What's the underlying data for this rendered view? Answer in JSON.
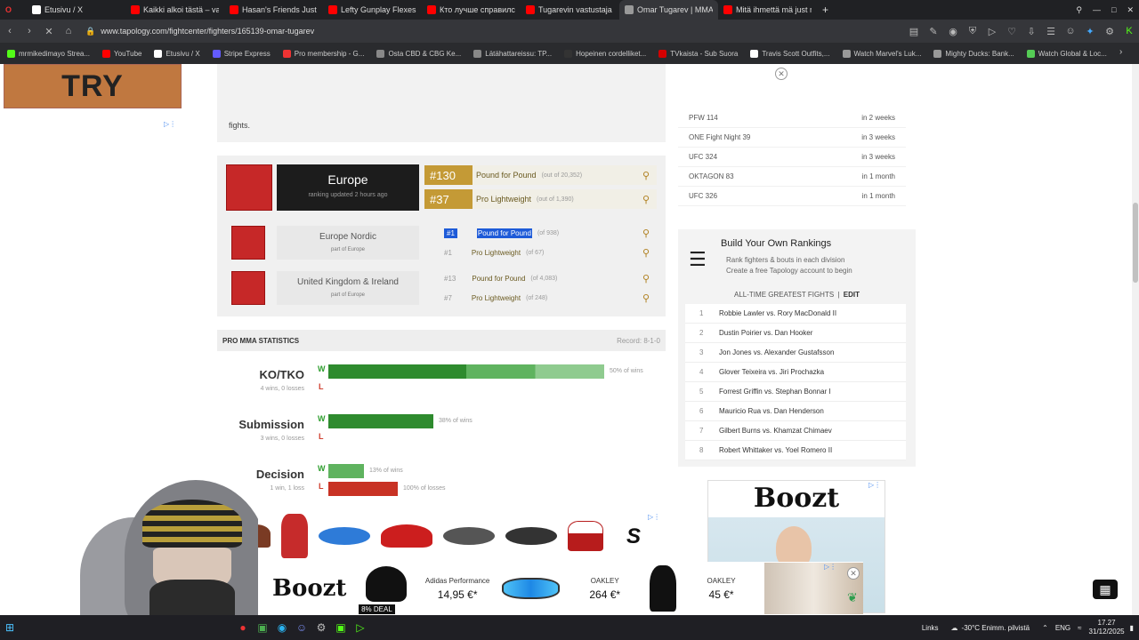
{
  "browser": {
    "tabs": [
      {
        "title": "Etusivu / X",
        "color": "#ffffff"
      },
      {
        "title": "Kaikki alkoi tästä – vapaas",
        "color": "#ff0000"
      },
      {
        "title": "Hasan's Friends Just Expo",
        "color": "#ff0000"
      },
      {
        "title": "Lefty Gunplay Flexes his C",
        "color": "#ff0000"
      },
      {
        "title": "Кто лучше справился?",
        "color": "#ff0000"
      },
      {
        "title": "Tugarevin vastustaja palja",
        "color": "#ff0000"
      },
      {
        "title": "Omar Tugarev | MMA Figh",
        "color": "#999999",
        "active": true
      },
      {
        "title": "Mitä ihmettä mä just näin",
        "color": "#ff0000"
      }
    ],
    "new_tab": "+",
    "url": "www.tapology.com/fightcenter/fighters/165139-omar-tugarev",
    "bookmarks": [
      {
        "label": "mrmikedimayo Strea...",
        "color": "#53fc18"
      },
      {
        "label": "YouTube",
        "color": "#ff0000"
      },
      {
        "label": "Etusivu / X",
        "color": "#ffffff"
      },
      {
        "label": "Stripe Express",
        "color": "#635bff"
      },
      {
        "label": "Pro membership - G...",
        "color": "#e33"
      },
      {
        "label": "Osta CBD & CBG Ke...",
        "color": "#888"
      },
      {
        "label": "Lätähattareissu: TP...",
        "color": "#888"
      },
      {
        "label": "Hopeinen cordelliket...",
        "color": "#333"
      },
      {
        "label": "TVkaista - Sub Suora",
        "color": "#d40000"
      },
      {
        "label": "Travis Scott Outfits,...",
        "color": "#fff"
      },
      {
        "label": "Watch Marvel's Luk...",
        "color": "#999"
      },
      {
        "label": "Mighty Ducks: Bank...",
        "color": "#999"
      },
      {
        "label": "Watch Global & Loc...",
        "color": "#5c5"
      }
    ]
  },
  "page": {
    "ad_try": "TRY",
    "fights_text": "fights.",
    "regions": {
      "europe": {
        "name": "Europe",
        "updated": "ranking updated 2 hours ago",
        "rank1": {
          "num": "#130",
          "label": "Pound for Pound",
          "of": "(out of 20,352)"
        },
        "rank2": {
          "num": "#37",
          "label": "Pro Lightweight",
          "of": "(out of 1,390)"
        }
      },
      "nordic": {
        "name": "Europe Nordic",
        "part": "part of Europe",
        "rank1": {
          "num": "#1",
          "label": "Pound for Pound",
          "of": "(of 938)"
        },
        "rank2": {
          "num": "#1",
          "label": "Pro Lightweight",
          "of": "(of 67)"
        }
      },
      "uk": {
        "name": "United Kingdom & Ireland",
        "part": "part of Europe",
        "rank1": {
          "num": "#13",
          "label": "Pound for Pound",
          "of": "(of 4,083)"
        },
        "rank2": {
          "num": "#7",
          "label": "Pro Lightweight",
          "of": "(of 248)"
        }
      }
    },
    "stats": {
      "title": "PRO MMA STATISTICS",
      "record": "Record: 8-1-0",
      "rows": [
        {
          "label": "KO/TKO",
          "sub": "4 wins, 0 losses",
          "w_pct": "50% of wins",
          "l_pct": "",
          "win_fraction": 0.5,
          "loss_fraction": 0
        },
        {
          "label": "Submission",
          "sub": "3 wins, 0 losses",
          "w_pct": "38% of wins",
          "l_pct": "",
          "win_fraction": 0.38,
          "loss_fraction": 0
        },
        {
          "label": "Decision",
          "sub": "1 win, 1 loss",
          "w_pct": "13% of wins",
          "l_pct": "100% of losses",
          "win_fraction": 0.13,
          "loss_fraction": 1.0
        }
      ],
      "w": "W",
      "l": "L"
    },
    "upcoming": [
      {
        "event": "PFW 114",
        "when": "in 2 weeks"
      },
      {
        "event": "ONE Fight Night 39",
        "when": "in 3 weeks"
      },
      {
        "event": "UFC 324",
        "when": "in 3 weeks"
      },
      {
        "event": "OKTAGON 83",
        "when": "in 1 month"
      },
      {
        "event": "UFC 326",
        "when": "in 1 month"
      }
    ],
    "build": {
      "title": "Build Your Own Rankings",
      "line1": "Rank fighters & bouts in each division",
      "line2": "Create a free Tapology account to begin",
      "gf_title": "ALL-TIME GREATEST FIGHTS",
      "edit": "EDIT",
      "fights": [
        "Robbie Lawler vs. Rory MacDonald II",
        "Dustin Poirier vs. Dan Hooker",
        "Jon Jones vs. Alexander Gustafsson",
        "Glover Teixeira vs. Jiri Prochazka",
        "Forrest Griffin vs. Stephan Bonnar I",
        "Mauricio Rua vs. Dan Henderson",
        "Gilbert Burns vs. Khamzat Chimaev",
        "Robert Whittaker vs. Yoel Romero II"
      ]
    },
    "ads": {
      "boozt_side": "Boozt",
      "boozt_bottom": "Boozt",
      "deal": "8% DEAL",
      "p1_brand": "Adidas Performance",
      "p1_price": "14,95 €*",
      "p2_brand": "OAKLEY",
      "p2_price": "264 €*",
      "p3_brand": "OAKLEY",
      "p3_price": "45 €*",
      "s_logo": "S"
    }
  },
  "taskbar": {
    "links": "Links",
    "weather": "-30°C  Enimm. pilvistä",
    "lang": "ENG",
    "time": "17.27",
    "date": "31/12/2025"
  }
}
